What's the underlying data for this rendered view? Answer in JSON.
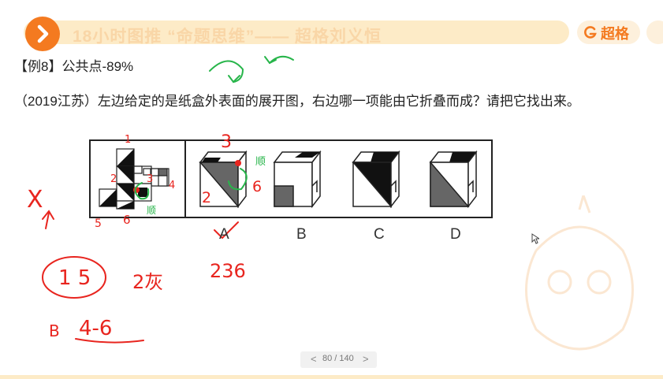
{
  "header": {
    "course_title": "18小时图推 “命题思维”—— 超格刘义恒",
    "brand_name": "超格"
  },
  "example": {
    "title": "【例8】公共点-89%",
    "question": "（2019江苏）左边给定的是纸盒外表面的展开图，右边哪一项能由它折叠而成？请把它找出来。"
  },
  "options": [
    "A",
    "B",
    "C",
    "D"
  ],
  "pager": {
    "prev": "<",
    "text": "80 / 140",
    "next": ">"
  },
  "annotations": {
    "net_numbers": [
      "1",
      "2",
      "3",
      "4",
      "5",
      "6"
    ],
    "net_shun": "顺",
    "cube_a_numbers": [
      "3",
      "2",
      "6"
    ],
    "cube_a_shun": "顺",
    "cross_mark": "X",
    "circled_15": "1 5",
    "two_gray": "2灰",
    "num_236": "236",
    "note_b": "B",
    "note_46": "4-6"
  },
  "colors": {
    "accent": "#f47a20",
    "header_bg": "#fdebc7",
    "annotation_red": "#e8251f",
    "annotation_green": "#27b54a"
  }
}
